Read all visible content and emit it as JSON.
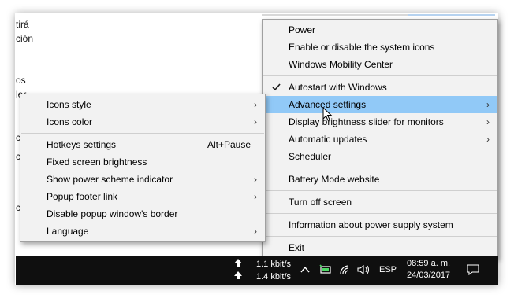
{
  "background_fragments": [
    "tirá",
    "ción",
    "os",
    "ler",
    "c",
    "c",
    "c"
  ],
  "main_menu": {
    "items": [
      {
        "label": "Power"
      },
      {
        "label": "Enable or disable the system icons"
      },
      {
        "label": "Windows Mobility Center"
      },
      {
        "label": "Autostart with Windows",
        "checked": true
      },
      {
        "label": "Advanced settings",
        "submenu": true,
        "highlighted": true
      },
      {
        "label": "Display brightness slider for monitors",
        "submenu": true
      },
      {
        "label": "Automatic updates",
        "submenu": true
      },
      {
        "label": "Scheduler"
      },
      {
        "label": "Battery Mode website"
      },
      {
        "label": "Turn off screen"
      },
      {
        "label": "Information about power supply system"
      },
      {
        "label": "Exit"
      }
    ]
  },
  "sub_menu": {
    "items": [
      {
        "label": "Icons style",
        "submenu": true
      },
      {
        "label": "Icons color",
        "submenu": true
      },
      {
        "label": "Hotkeys settings",
        "shortcut": "Alt+Pause"
      },
      {
        "label": "Fixed screen brightness"
      },
      {
        "label": "Show power scheme indicator",
        "submenu": true
      },
      {
        "label": "Popup footer link",
        "submenu": true
      },
      {
        "label": "Disable popup window's border"
      },
      {
        "label": "Language",
        "submenu": true
      }
    ]
  },
  "taskbar": {
    "upload_speed": "1.1 kbit/s",
    "download_speed": "1.4 kbit/s",
    "language": "ESP",
    "time": "08:59 a. m.",
    "date": "24/03/2017"
  },
  "colors": {
    "menu_bg": "#f2f2f2",
    "highlight": "#91c9f7",
    "taskbar": "#0f0f0f"
  }
}
